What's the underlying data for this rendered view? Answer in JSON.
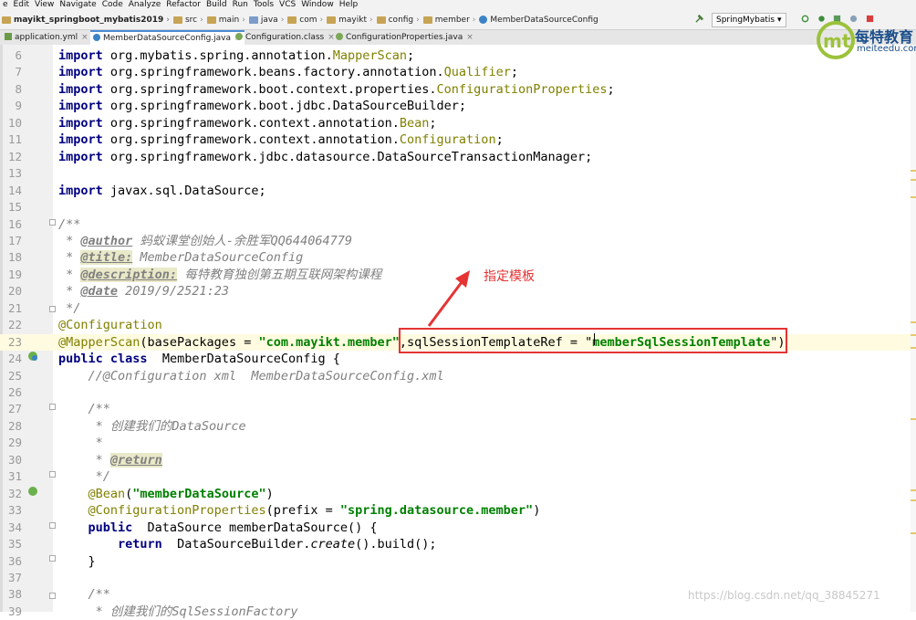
{
  "menu": [
    "e",
    "Edit",
    "View",
    "Navigate",
    "Code",
    "Analyze",
    "Refactor",
    "Build",
    "Run",
    "Tools",
    "VCS",
    "Window",
    "Help"
  ],
  "breadcrumbs": [
    "mayikt_springboot_mybatis2019",
    "src",
    "main",
    "java",
    "com",
    "mayikt",
    "config",
    "member",
    "MemberDataSourceConfig"
  ],
  "run_config": "SpringMybatis",
  "tabs": [
    {
      "label": "application.yml",
      "active": false
    },
    {
      "label": "MemberDataSourceConfig.java",
      "active": true
    },
    {
      "label": "Configuration.class",
      "active": false
    },
    {
      "label": "ConfigurationProperties.java",
      "active": false
    }
  ],
  "code_lines": [
    {
      "n": "6",
      "tokens": [
        [
          "kw",
          "import"
        ],
        [
          "",
          "org.mybatis.spring.annotation."
        ],
        [
          "cl",
          "MapperScan"
        ],
        [
          "",
          ";"
        ]
      ]
    },
    {
      "n": "7",
      "tokens": [
        [
          "kw",
          "import"
        ],
        [
          "",
          "org.springframework.beans.factory.annotation."
        ],
        [
          "cl",
          "Qualifier"
        ],
        [
          "",
          ";"
        ]
      ]
    },
    {
      "n": "8",
      "tokens": [
        [
          "kw",
          "import"
        ],
        [
          "",
          "org.springframework.boot.context.properties."
        ],
        [
          "cl",
          "ConfigurationProperties"
        ],
        [
          "",
          ";"
        ]
      ]
    },
    {
      "n": "9",
      "tokens": [
        [
          "kw",
          "import"
        ],
        [
          "",
          "org.springframework.boot.jdbc.DataSourceBuilder;"
        ]
      ]
    },
    {
      "n": "10",
      "tokens": [
        [
          "kw",
          "import"
        ],
        [
          "",
          "org.springframework.context.annotation."
        ],
        [
          "cl",
          "Bean"
        ],
        [
          "",
          ";"
        ]
      ]
    },
    {
      "n": "11",
      "tokens": [
        [
          "kw",
          "import"
        ],
        [
          "",
          "org.springframework.context.annotation."
        ],
        [
          "cl",
          "Configuration"
        ],
        [
          "",
          ";"
        ]
      ]
    },
    {
      "n": "12",
      "tokens": [
        [
          "kw",
          "import"
        ],
        [
          "",
          "org.springframework.jdbc.datasource.DataSourceTransactionManager;"
        ]
      ]
    },
    {
      "n": "13",
      "tokens": []
    },
    {
      "n": "14",
      "tokens": [
        [
          "kw",
          "import"
        ],
        [
          "",
          "javax.sql.DataSource;"
        ]
      ]
    },
    {
      "n": "15",
      "tokens": []
    },
    {
      "n": "16",
      "tokens": [
        [
          "jd",
          "/**"
        ]
      ]
    },
    {
      "n": "17",
      "tokens": [
        [
          "jd",
          " * "
        ],
        [
          "tag",
          "@author"
        ],
        [
          "jd",
          " 蚂蚁课堂创始人-余胜军QQ644064779"
        ]
      ]
    },
    {
      "n": "18",
      "tokens": [
        [
          "jd",
          " * "
        ],
        [
          "tag tagbg",
          "@title:"
        ],
        [
          "jd",
          " MemberDataSourceConfig"
        ]
      ]
    },
    {
      "n": "19",
      "tokens": [
        [
          "jd",
          " * "
        ],
        [
          "tag tagbg",
          "@description:"
        ],
        [
          "jd",
          " 每特教育独创第五期互联网架构课程"
        ]
      ]
    },
    {
      "n": "20",
      "tokens": [
        [
          "jd",
          " * "
        ],
        [
          "tag",
          "@date"
        ],
        [
          "jd",
          " 2019/9/2521:23"
        ]
      ]
    },
    {
      "n": "21",
      "tokens": [
        [
          "jd",
          " */"
        ]
      ]
    },
    {
      "n": "22",
      "tokens": [
        [
          "an",
          "@Configuration"
        ]
      ]
    },
    {
      "n": "23",
      "hl": true,
      "tokens": [
        [
          "an",
          "@MapperScan"
        ],
        [
          "",
          "(basePackages = "
        ],
        [
          "str",
          "\"com.mayikt.member\""
        ],
        [
          "",
          ",sqlSessionTemplateRef = \""
        ],
        [
          "str",
          "memberSqlSessionTemplate"
        ],
        [
          "",
          "\")"
        ]
      ]
    },
    {
      "n": "24",
      "tokens": [
        [
          "kw",
          "public class"
        ],
        [
          "",
          " MemberDataSourceConfig {"
        ]
      ]
    },
    {
      "n": "25",
      "tokens": [
        [
          "cm",
          "    //@Configuration xml  MemberDataSourceConfig.xml"
        ]
      ]
    },
    {
      "n": "26",
      "tokens": []
    },
    {
      "n": "27",
      "tokens": [
        [
          "jd",
          "    /**"
        ]
      ]
    },
    {
      "n": "28",
      "tokens": [
        [
          "jd",
          "     * 创建我们的DataSource"
        ]
      ]
    },
    {
      "n": "29",
      "tokens": [
        [
          "jd",
          "     *"
        ]
      ]
    },
    {
      "n": "30",
      "tokens": [
        [
          "jd",
          "     * "
        ],
        [
          "tag tagbg",
          "@return"
        ]
      ]
    },
    {
      "n": "31",
      "tokens": [
        [
          "jd",
          "     */"
        ]
      ]
    },
    {
      "n": "32",
      "tokens": [
        [
          "an",
          "    @Bean"
        ],
        [
          "",
          "("
        ],
        [
          "str",
          "\"memberDataSource\""
        ],
        [
          "",
          ")"
        ]
      ]
    },
    {
      "n": "33",
      "tokens": [
        [
          "an",
          "    @ConfigurationProperties"
        ],
        [
          "",
          "(prefix = "
        ],
        [
          "str",
          "\"spring.datasource.member\""
        ],
        [
          "",
          ")"
        ]
      ]
    },
    {
      "n": "34",
      "tokens": [
        [
          "kw",
          "    public"
        ],
        [
          "",
          " DataSource memberDataSource() {"
        ]
      ]
    },
    {
      "n": "35",
      "tokens": [
        [
          "kw",
          "        return"
        ],
        [
          "",
          " DataSourceBuilder."
        ],
        [
          "st",
          "create"
        ],
        [
          "",
          "().build();"
        ]
      ]
    },
    {
      "n": "36",
      "tokens": [
        [
          "",
          "    }"
        ]
      ]
    },
    {
      "n": "37",
      "tokens": []
    },
    {
      "n": "38",
      "tokens": [
        [
          "jd",
          "    /**"
        ]
      ]
    },
    {
      "n": "39",
      "tokens": [
        [
          "jd",
          "     * 创建我们的SqlSessionFactory"
        ]
      ]
    }
  ],
  "annotation": {
    "text": "指定模板",
    "color": "#e53333"
  },
  "logo": {
    "title": "每特教育",
    "subtitle": "meiteedu.com"
  },
  "watermark": "https://blog.csdn.net/qq_38845271",
  "colors": {
    "keyword": "#000080",
    "annotation": "#808000",
    "string": "#008000",
    "comment": "#808080",
    "highlight": "#fffbe0",
    "accent": "#4a8bd6"
  }
}
